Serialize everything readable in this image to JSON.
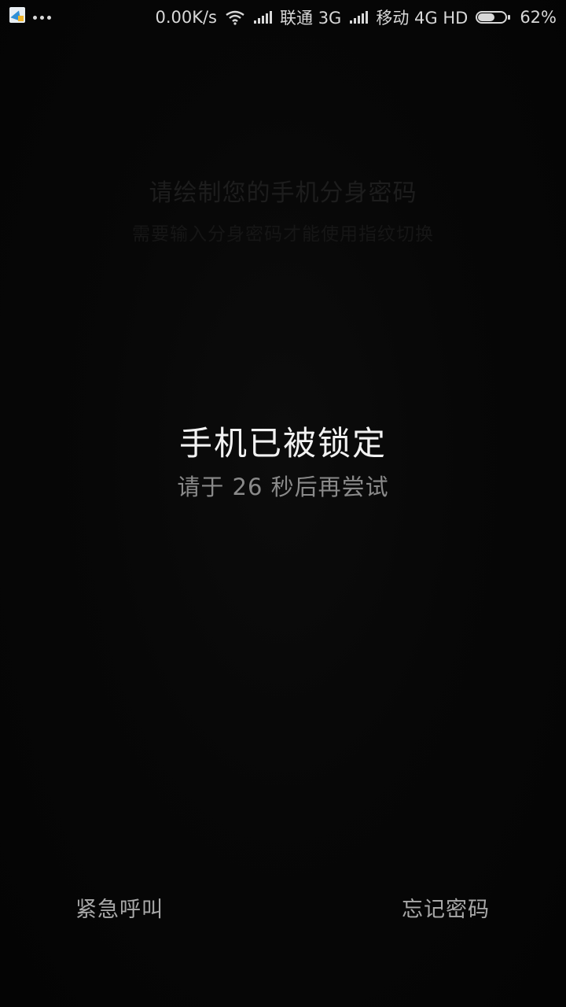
{
  "status_bar": {
    "app_icon": "notification-app-icon",
    "more_icon": "more-dots-icon",
    "net_speed": "0.00K/s",
    "carrier1": "联通",
    "network1": "3G",
    "carrier2": "移动",
    "network2": "4G",
    "hd": "HD",
    "battery_percent": "62%",
    "battery_level": 0.62
  },
  "background_prompt": {
    "title": "请绘制您的手机分身密码",
    "subtitle": "需要输入分身密码才能使用指纹切换"
  },
  "lock": {
    "title": "手机已被锁定",
    "countdown": "请于 26 秒后再尝试"
  },
  "actions": {
    "emergency": "紧急呼叫",
    "forgot": "忘记密码"
  },
  "colors": {
    "background": "#050505",
    "primary_text": "#f2f2f2",
    "secondary_text": "#8a8a8a"
  }
}
